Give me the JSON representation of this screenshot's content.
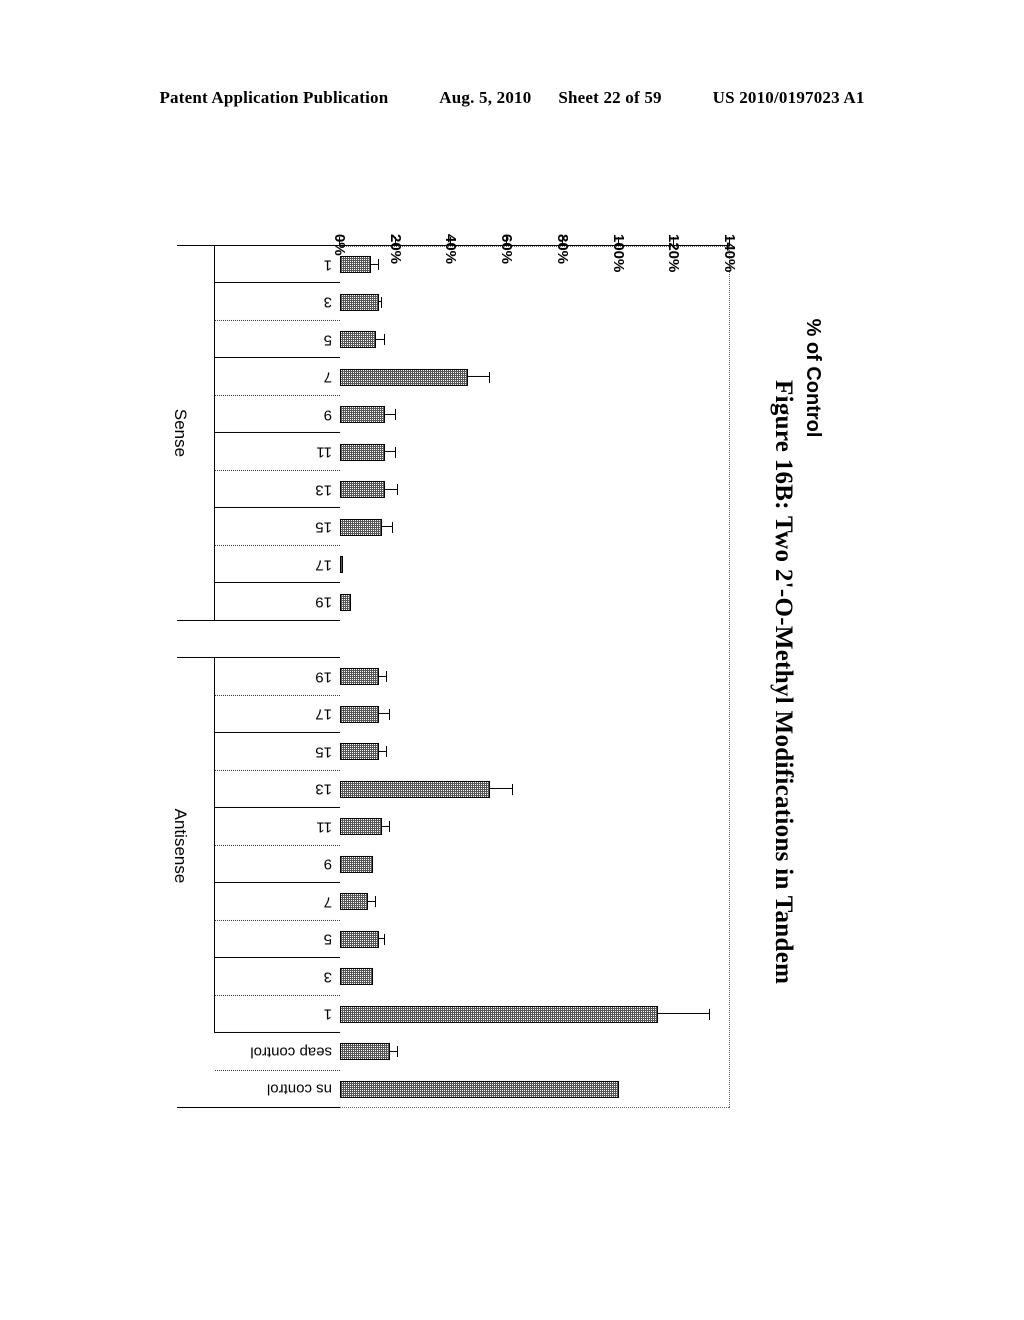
{
  "header": {
    "publication": "Patent Application Publication",
    "date": "Aug. 5, 2010",
    "sheet": "Sheet 22 of 59",
    "patent_number": "US 2010/0197023 A1"
  },
  "figure": {
    "caption": "Figure 16B: Two 2'-O-Methyl Modifications in Tandem"
  },
  "chart_data": {
    "type": "bar",
    "orientation": "horizontal",
    "title": "Figure 16B: Two 2'-O-Methyl Modifications in Tandem",
    "xlabel": "",
    "ylabel": "% of Control",
    "ylim": [
      0,
      140
    ],
    "tick_labels": [
      "140%",
      "120%",
      "100%",
      "80%",
      "60%",
      "40%",
      "20%",
      "0%"
    ],
    "tick_values": [
      140,
      120,
      100,
      80,
      60,
      40,
      20,
      0
    ],
    "grid": false,
    "groups": [
      {
        "name": "Antisense",
        "categories": [
          "1",
          "3",
          "5",
          "7",
          "9",
          "11",
          "13",
          "15",
          "17",
          "19"
        ]
      },
      {
        "name": "Sense",
        "categories": [
          "19",
          "17",
          "15",
          "13",
          "11",
          "9",
          "7",
          "5",
          "3",
          "1"
        ]
      }
    ],
    "categories": [
      "ns control",
      "seap control",
      "1",
      "3",
      "5",
      "7",
      "9",
      "11",
      "13",
      "15",
      "17",
      "19",
      "19",
      "17",
      "15",
      "13",
      "11",
      "9",
      "7",
      "5",
      "3",
      "1"
    ],
    "values": [
      100,
      18,
      114,
      12,
      14,
      10,
      12,
      15,
      54,
      14,
      14,
      14,
      4,
      1,
      15,
      16,
      16,
      16,
      46,
      13,
      14,
      11
    ],
    "errors": [
      0,
      3,
      19,
      0,
      2,
      3,
      0,
      3,
      8,
      3,
      4,
      3,
      0,
      0,
      4,
      5,
      4,
      4,
      8,
      3,
      1,
      3
    ]
  }
}
